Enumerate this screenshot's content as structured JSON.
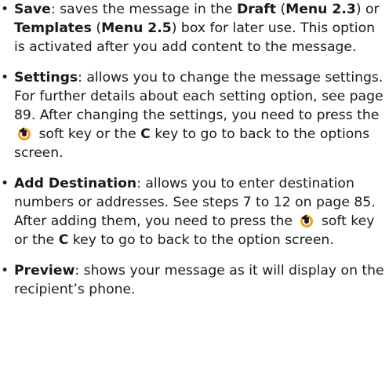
{
  "items": [
    {
      "term": "Save",
      "text_a": ": saves the message in the ",
      "bold_a": "Draft",
      "text_b": " (",
      "bold_b": "Menu 2.3",
      "text_c": ") or ",
      "bold_c": "Templates",
      "text_d": " (",
      "bold_d": "Menu 2.5",
      "text_e": ") box for later use. This option is activated after you add content to the message."
    },
    {
      "term": "Settings",
      "text_a": ": allows you to change the message settings. For further details about each setting option, see page 89. After changing the settings, you need to press the ",
      "text_b": " soft key or the ",
      "bold_b": "C",
      "text_c": " key to go to back to the options screen."
    },
    {
      "term": "Add Destination",
      "text_a": ": allows you to enter destination numbers or addresses. See steps 7 to 12 on page 85. After adding them, you need to press the ",
      "text_b": " soft key or the ",
      "bold_b": "C",
      "text_c": " key to go to back to the option screen."
    },
    {
      "term": "Preview",
      "text_a": ": shows your message as it will display on the recipient’s phone."
    }
  ],
  "bullet": "•",
  "icons": {
    "back_key": "back-arrow-icon"
  },
  "colors": {
    "text": "#1a1a1a",
    "icon_ring": "#f0a020",
    "icon_body": "#1a1a1a"
  }
}
